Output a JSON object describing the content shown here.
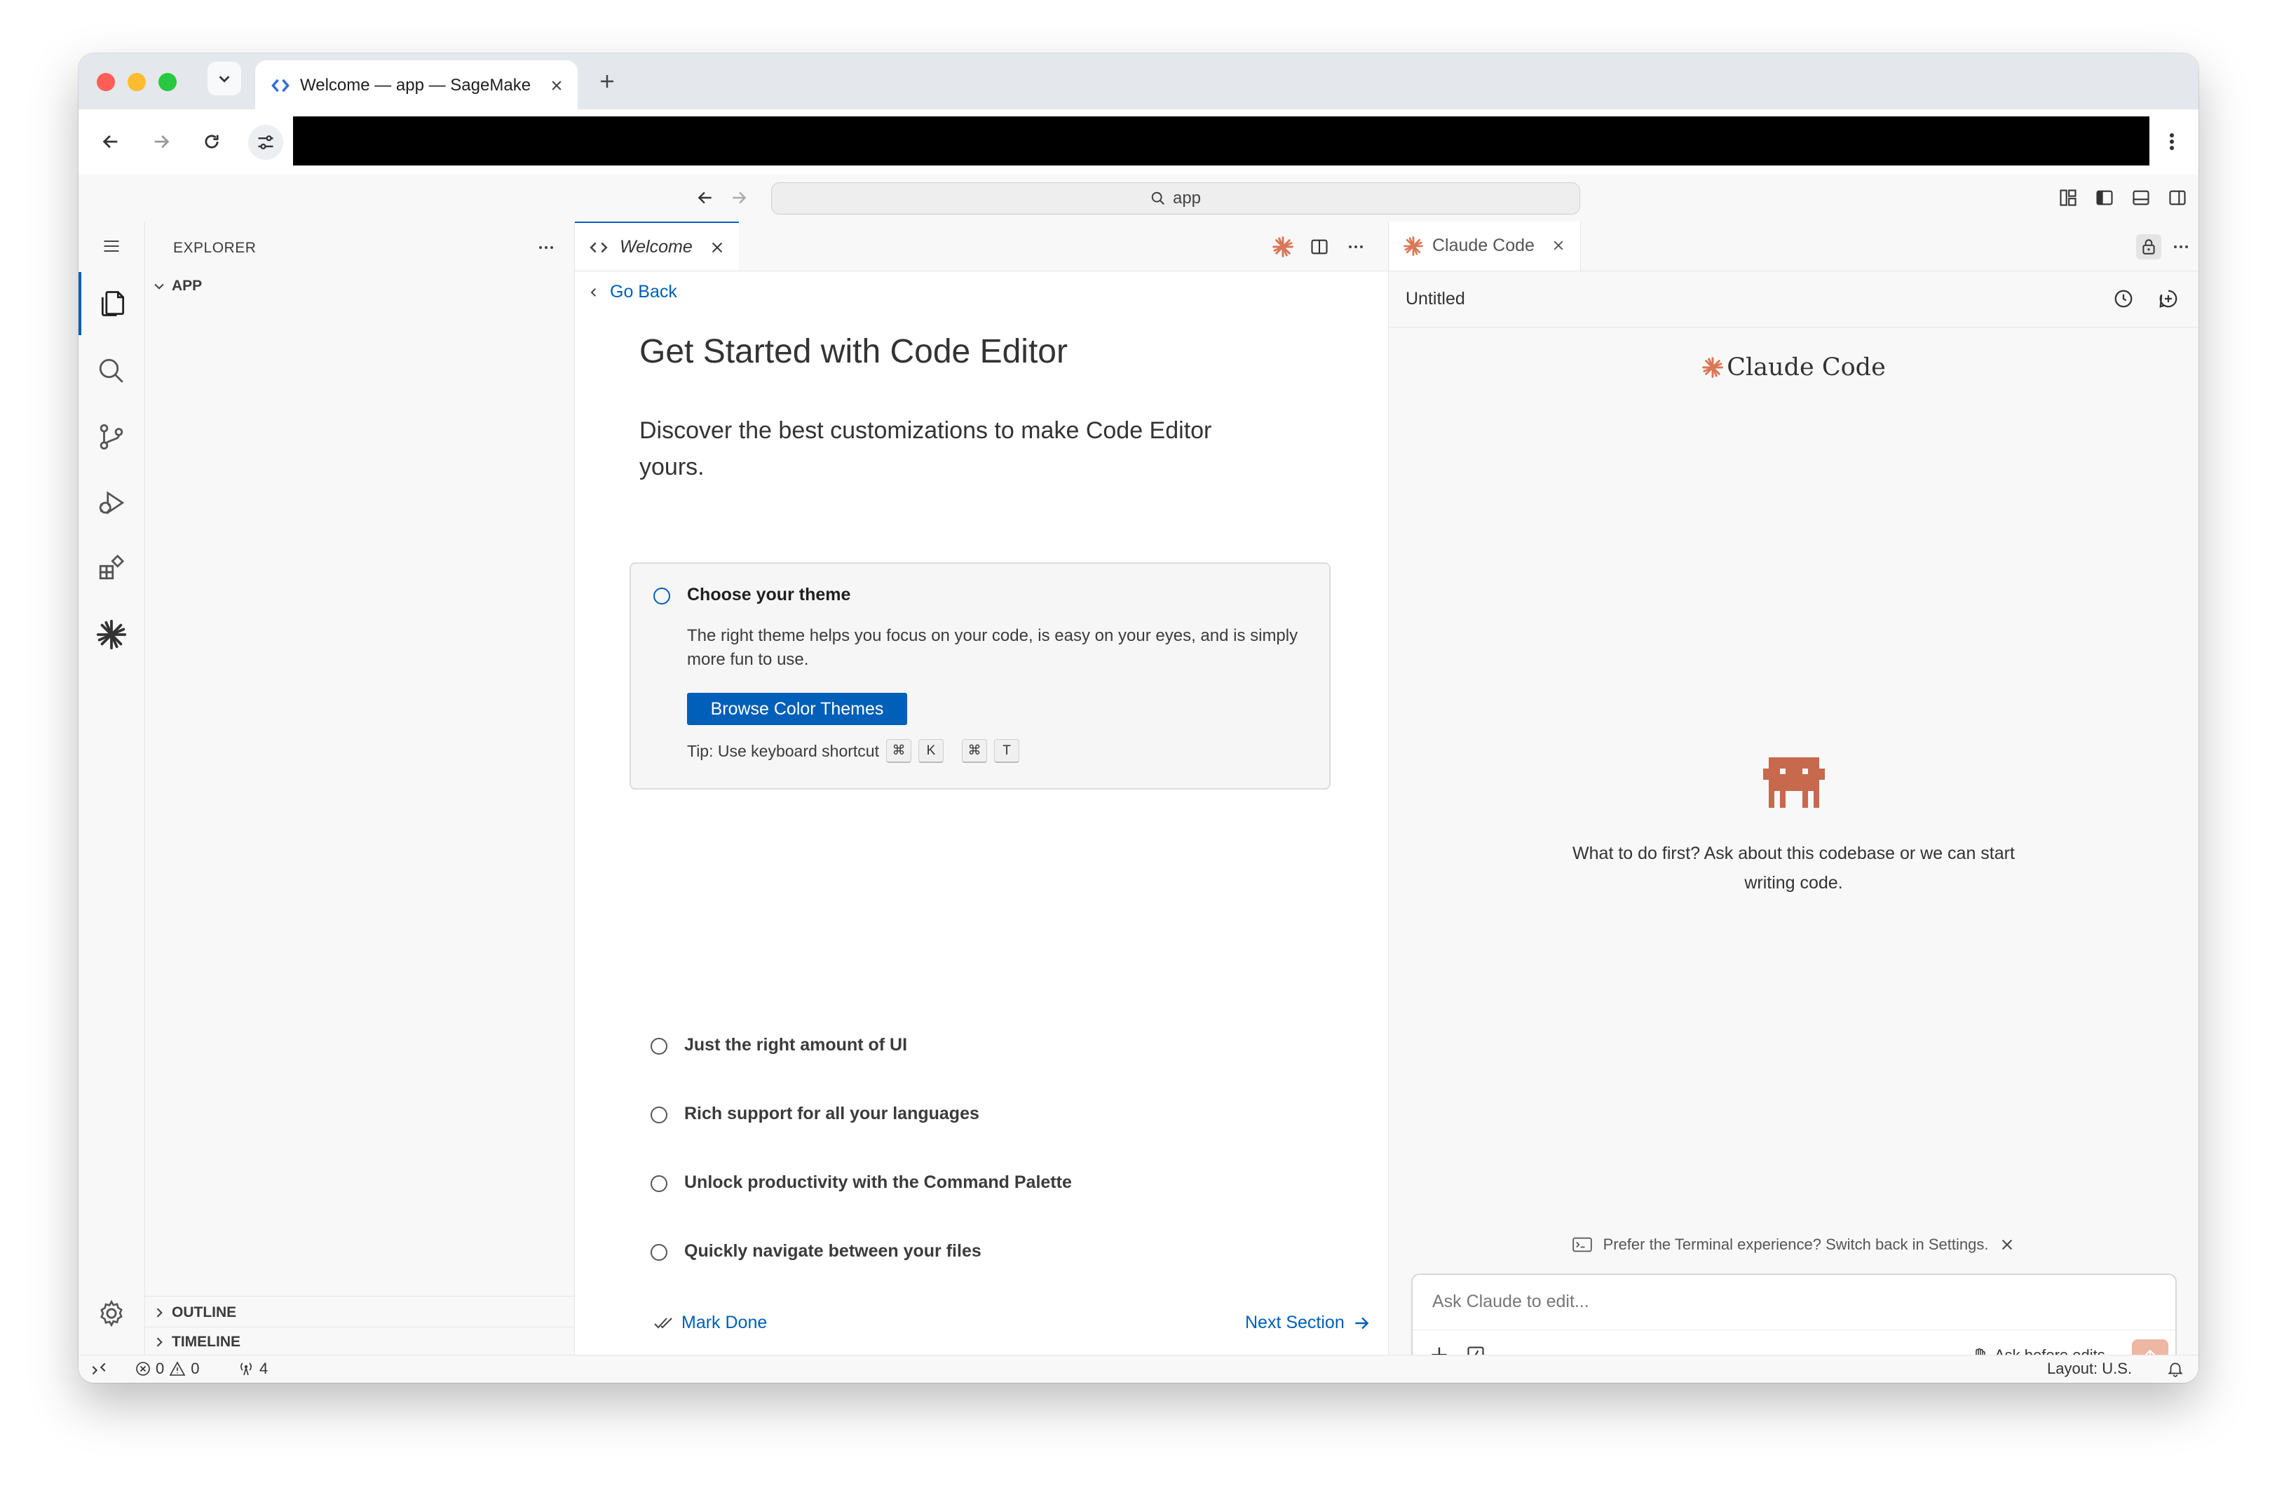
{
  "browser": {
    "tab_title": "Welcome — app — SageMaker Code Editor",
    "new_tab_label": "+"
  },
  "titlebar": {
    "search_text": "app"
  },
  "sidebar": {
    "title": "EXPLORER",
    "root_folder": "APP",
    "outline_label": "OUTLINE",
    "timeline_label": "TIMELINE"
  },
  "editor": {
    "tab_label": "Welcome",
    "go_back": "Go Back",
    "title": "Get Started with Code Editor",
    "subtitle": "Discover the best customizations to make Code Editor yours.",
    "card": {
      "title": "Choose your theme",
      "description": "The right theme helps you focus on your code, is easy on your eyes, and is simply more fun to use.",
      "button": "Browse Color Themes",
      "tip_label": "Tip: Use keyboard shortcut",
      "keys": [
        "⌘",
        "K",
        "⌘",
        "T"
      ]
    },
    "steps": [
      "Just the right amount of UI",
      "Rich support for all your languages",
      "Unlock productivity with the Command Palette",
      "Quickly navigate between your files"
    ],
    "mark_done": "Mark Done",
    "next_section": "Next Section"
  },
  "claude": {
    "tab_label": "Claude Code",
    "header_title": "Untitled",
    "brand_name": "Claude Code",
    "message": "What to do first? Ask about this codebase or we can start writing code.",
    "notice": "Prefer the Terminal experience? Switch back in Settings.",
    "input_placeholder": "Ask Claude to edit...",
    "mode_label": "Ask before edits"
  },
  "statusbar": {
    "errors": "0",
    "warnings": "0",
    "ports": "4",
    "layout": "Layout: U.S."
  },
  "colors": {
    "accent": "#005fb8",
    "claude_orange": "#d97757",
    "robot": "#c7694c"
  }
}
